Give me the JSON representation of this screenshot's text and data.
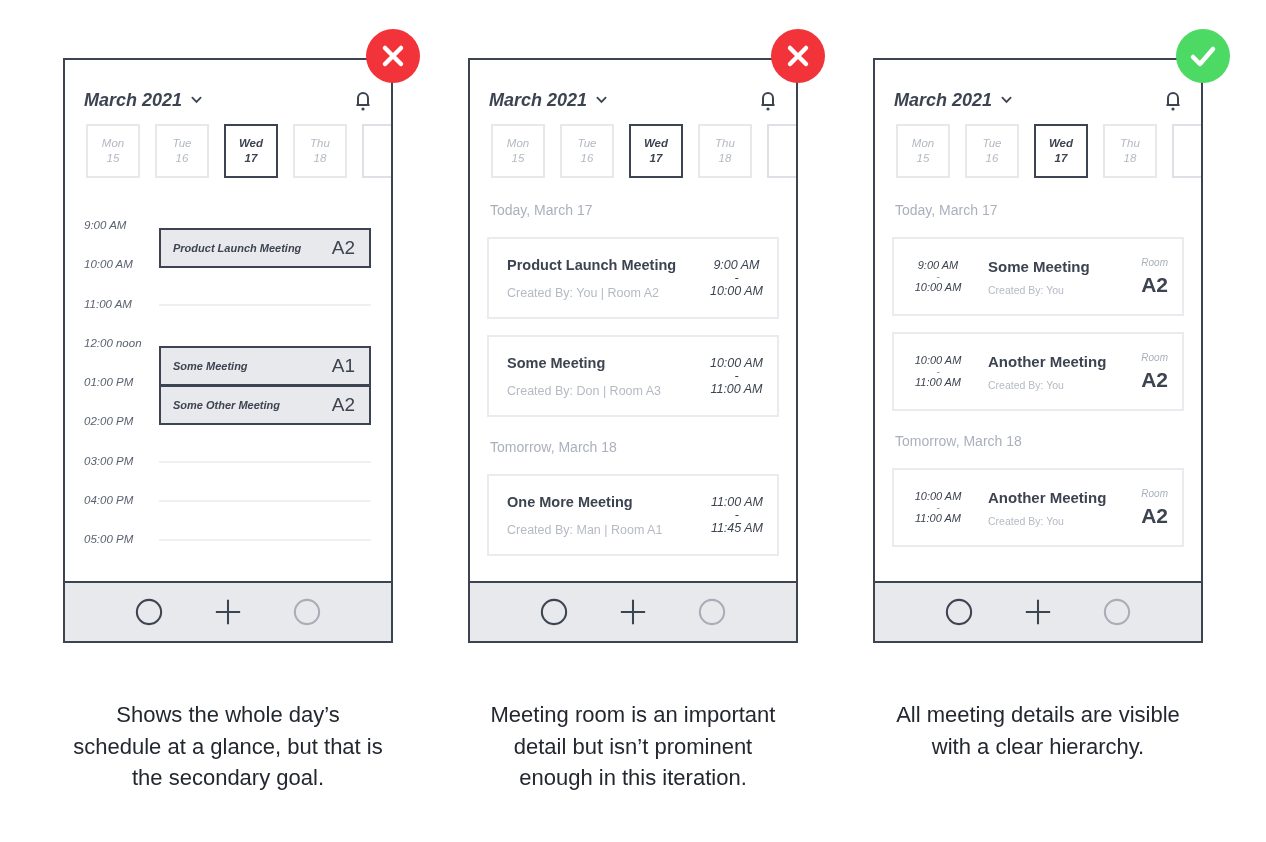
{
  "variants": [
    {
      "kind": "timeline",
      "badge": {
        "kind": "rejected"
      },
      "month": "March 2021",
      "days": [
        {
          "weekday": "Mon",
          "date": "15",
          "selected": false
        },
        {
          "weekday": "Tue",
          "date": "16",
          "selected": false
        },
        {
          "weekday": "Wed",
          "date": "17",
          "selected": true
        },
        {
          "weekday": "Thu",
          "date": "18",
          "selected": false
        }
      ],
      "slots": [
        {
          "time": "9:00 AM",
          "kind": "event",
          "title": "Product Launch Meeting",
          "room": "A2"
        },
        {
          "time": "10:00 AM",
          "kind": "empty"
        },
        {
          "time": "11:00 AM",
          "kind": "line"
        },
        {
          "time": "12:00 noon",
          "kind": "event",
          "title": "Some Meeting",
          "room": "A1"
        },
        {
          "time": "01:00 PM",
          "kind": "event",
          "title": "Some Other Meeting",
          "room": "A2"
        },
        {
          "time": "02:00 PM",
          "kind": "empty"
        },
        {
          "time": "03:00 PM",
          "kind": "line"
        },
        {
          "time": "04:00 PM",
          "kind": "line"
        },
        {
          "time": "05:00 PM",
          "kind": "line"
        }
      ],
      "caption": "Shows the whole day’s schedule at a glance, but that is the secondary goal."
    },
    {
      "kind": "list",
      "badge": {
        "kind": "rejected"
      },
      "month": "March 2021",
      "days": [
        {
          "weekday": "Mon",
          "date": "15",
          "selected": false
        },
        {
          "weekday": "Tue",
          "date": "16",
          "selected": false
        },
        {
          "weekday": "Wed",
          "date": "17",
          "selected": true
        },
        {
          "weekday": "Thu",
          "date": "18",
          "selected": false
        }
      ],
      "sections": [
        {
          "heading": "Today, March 17",
          "meetings": [
            {
              "title": "Product Launch Meeting",
              "details": "Created By: You | Room A2",
              "start": "9:00 AM",
              "dash": "-",
              "end": "10:00 AM"
            },
            {
              "title": "Some Meeting",
              "details": "Created By: Don | Room A3",
              "start": "10:00 AM",
              "dash": "-",
              "end": "11:00 AM"
            }
          ]
        },
        {
          "heading": "Tomorrow, March 18",
          "meetings": [
            {
              "title": "One More Meeting",
              "details": "Created By: Man | Room A1",
              "start": "11:00 AM",
              "dash": "-",
              "end": "11:45 AM"
            }
          ]
        }
      ],
      "caption": "Meeting room is an important detail but isn’t prominent enough in this iteration."
    },
    {
      "kind": "cards",
      "badge": {
        "kind": "approved"
      },
      "month": "March 2021",
      "days": [
        {
          "weekday": "Mon",
          "date": "15",
          "selected": false
        },
        {
          "weekday": "Tue",
          "date": "16",
          "selected": false
        },
        {
          "weekday": "Wed",
          "date": "17",
          "selected": true
        },
        {
          "weekday": "Thu",
          "date": "18",
          "selected": false
        }
      ],
      "sections": [
        {
          "heading": "Today, March 17",
          "meetings": [
            {
              "title": "Some Meeting",
              "creator": "Created By: You",
              "start": "9:00 AM",
              "dash": "-",
              "end": "10:00 AM",
              "room_label": "Room",
              "room": "A2"
            },
            {
              "title": "Another Meeting",
              "creator": "Created By: You",
              "start": "10:00 AM",
              "dash": "-",
              "end": "11:00 AM",
              "room_label": "Room",
              "room": "A2"
            }
          ]
        },
        {
          "heading": "Tomorrow, March 18",
          "meetings": [
            {
              "title": "Another Meeting",
              "creator": "Created By: You",
              "start": "10:00 AM",
              "dash": "-",
              "end": "11:00 AM",
              "room_label": "Room",
              "room": "A2"
            }
          ]
        }
      ],
      "caption": "All meeting details are visible with a clear hierarchy."
    }
  ]
}
